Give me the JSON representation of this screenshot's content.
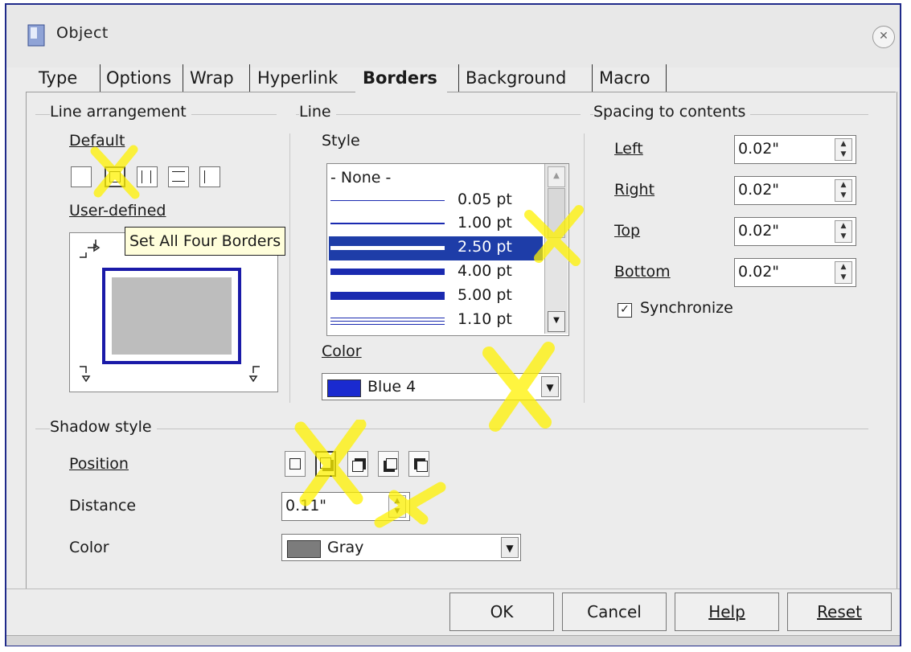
{
  "window": {
    "title": "Object"
  },
  "tabs": [
    "Type",
    "Options",
    "Wrap",
    "Hyperlink",
    "Borders",
    "Background",
    "Macro"
  ],
  "active_tab": "Borders",
  "line_arrangement": {
    "heading": "Line arrangement",
    "default_label": "Default",
    "user_defined_label": "User-defined",
    "tooltip": "Set All Four Borders"
  },
  "line": {
    "heading": "Line",
    "style_label": "Style",
    "styles": [
      {
        "label": "- None -"
      },
      {
        "label": "0.05 pt"
      },
      {
        "label": "1.00 pt"
      },
      {
        "label": "2.50 pt",
        "selected": true
      },
      {
        "label": "4.00 pt"
      },
      {
        "label": "5.00 pt"
      },
      {
        "label": "1.10 pt"
      }
    ],
    "color_label": "Color",
    "color_value": "Blue 4",
    "color_hex": "#1a2ad0"
  },
  "spacing": {
    "heading": "Spacing to contents",
    "left_label": "Left",
    "left_value": "0.02\"",
    "right_label": "Right",
    "right_value": "0.02\"",
    "top_label": "Top",
    "top_value": "0.02\"",
    "bottom_label": "Bottom",
    "bottom_value": "0.02\"",
    "synchronize_label": "Synchronize",
    "synchronize_checked": true
  },
  "shadow": {
    "heading": "Shadow style",
    "position_label": "Position",
    "distance_label": "Distance",
    "distance_value": "0.11\"",
    "color_label": "Color",
    "color_value": "Gray",
    "color_hex": "#7c7c7c"
  },
  "buttons": {
    "ok": "OK",
    "cancel": "Cancel",
    "help": "Help",
    "reset": "Reset"
  },
  "colors": {
    "highlight": "#fff200",
    "selection": "#1e3da8",
    "frame": "#1f2a8a"
  }
}
